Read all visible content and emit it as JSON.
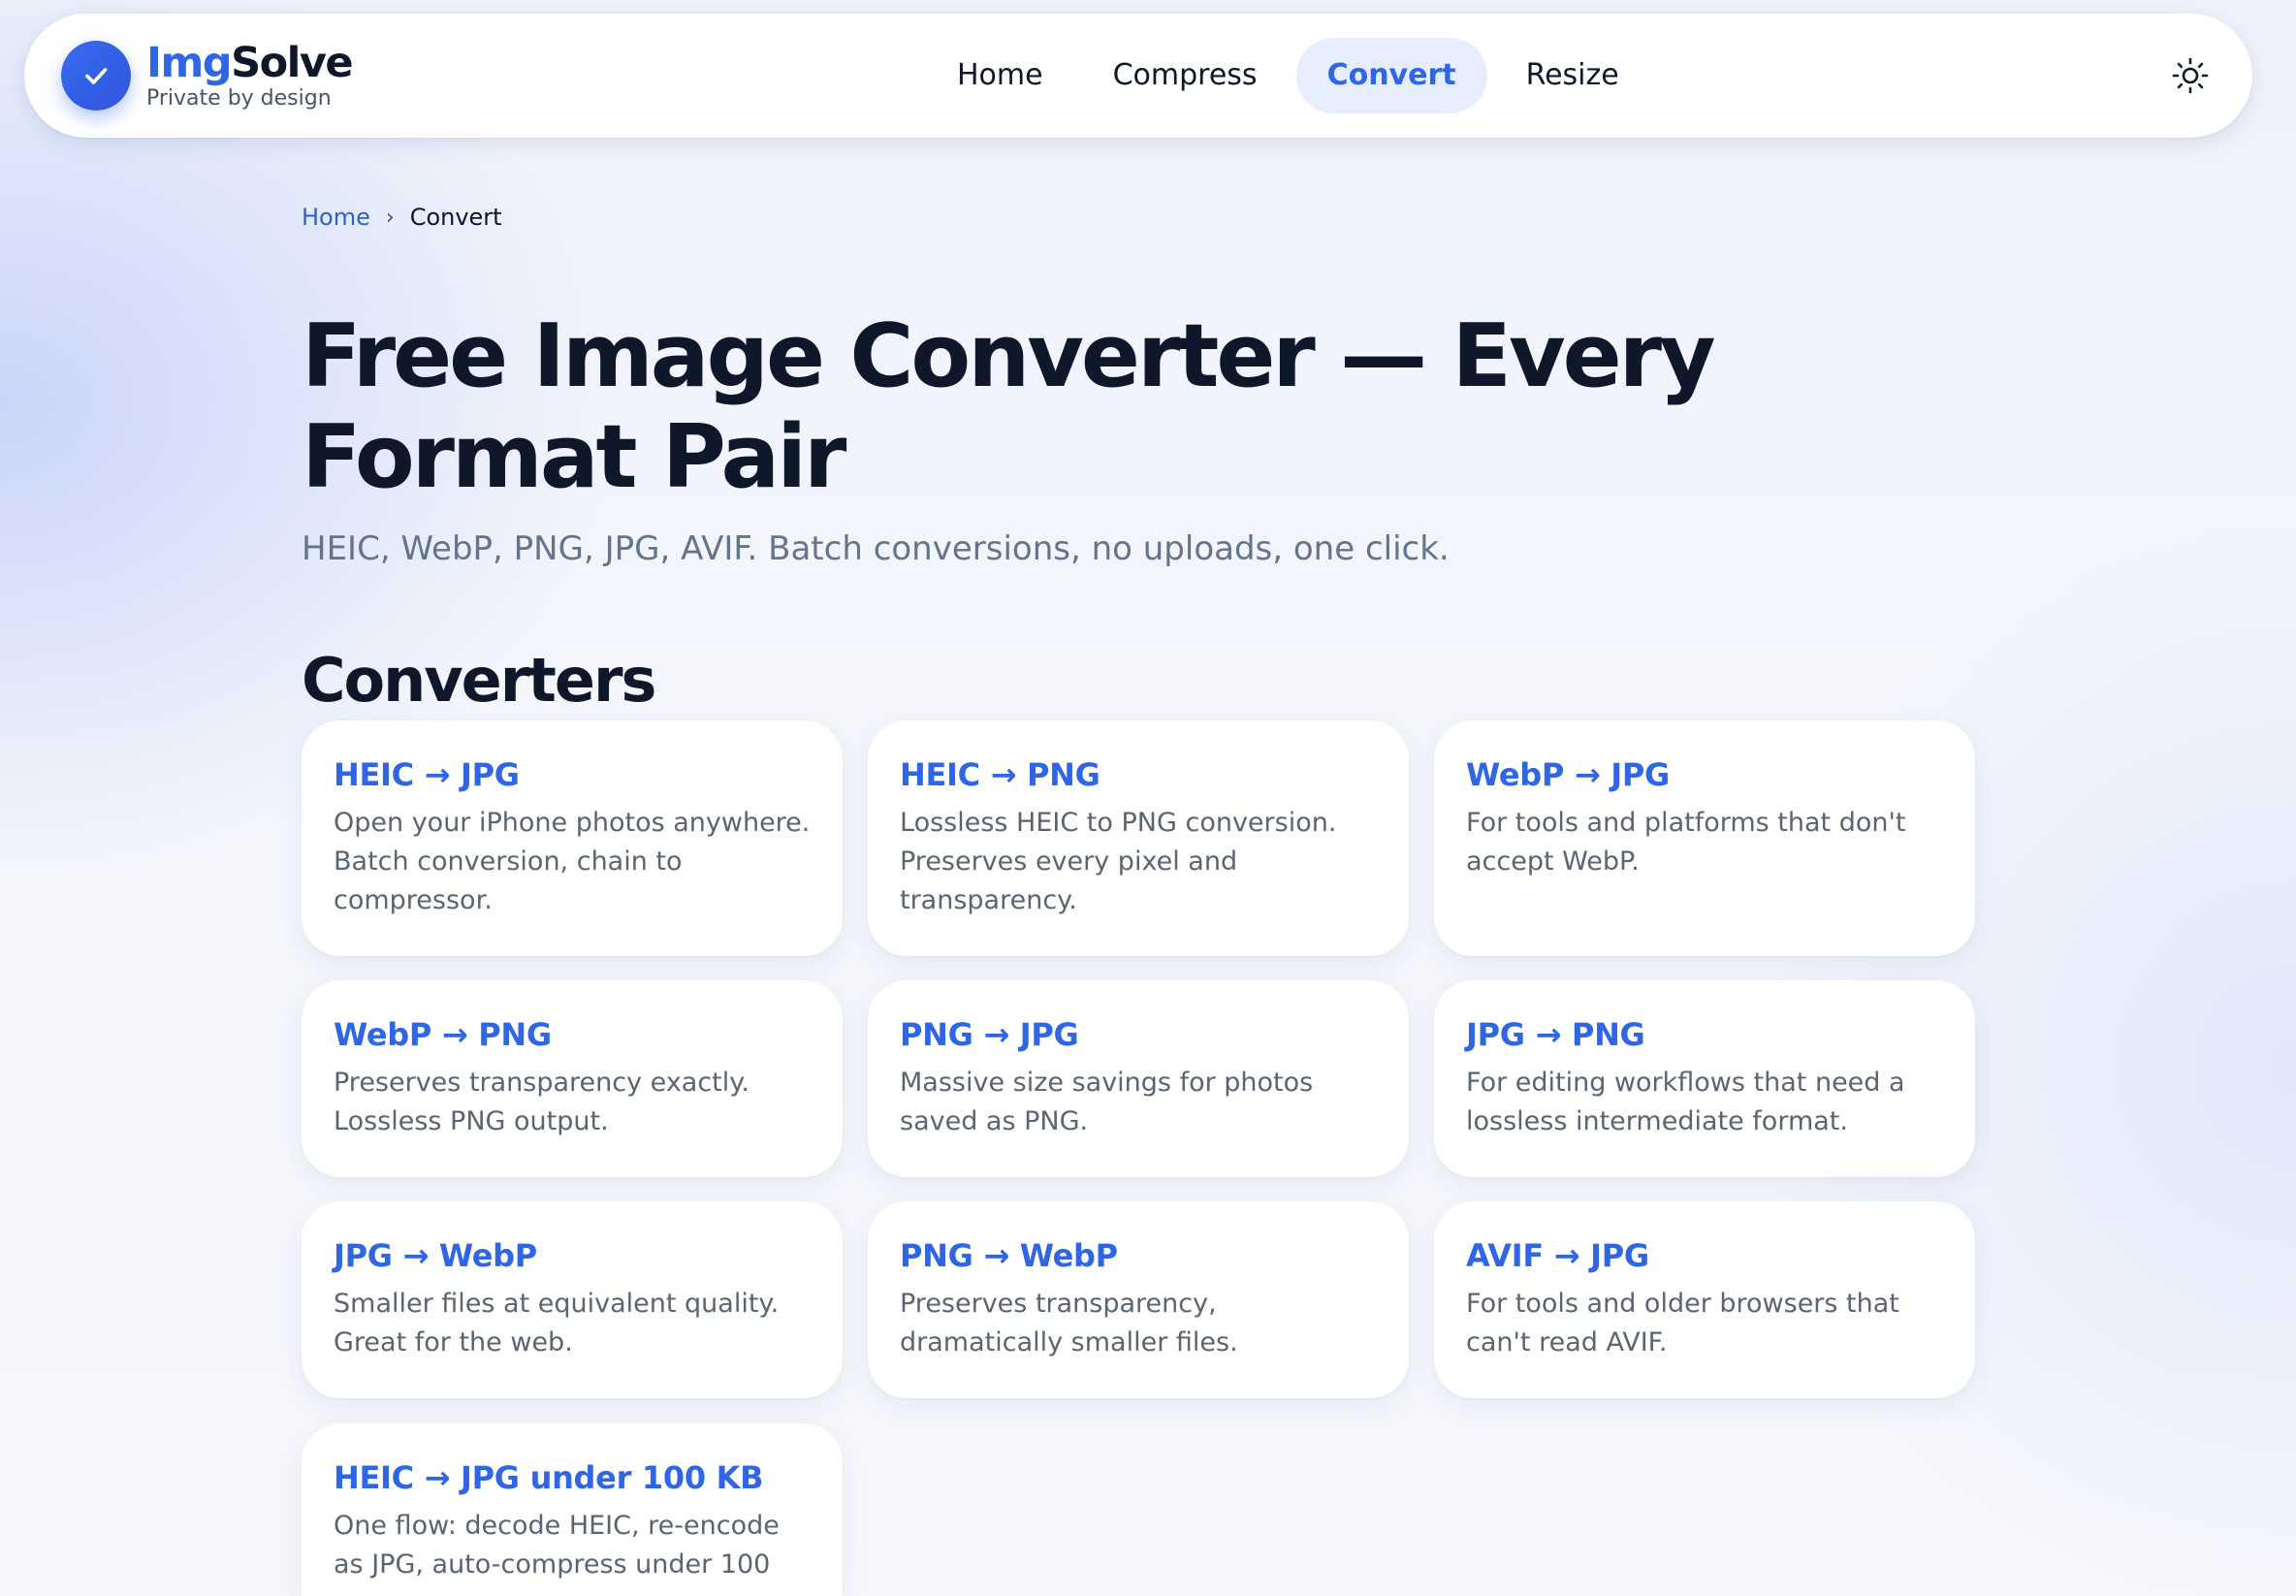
{
  "header": {
    "brand_name_part1": "Img",
    "brand_name_part2": "Solve",
    "brand_tagline": "Private by design",
    "brand_icon": "check-icon",
    "nav": [
      {
        "label": "Home",
        "active": false
      },
      {
        "label": "Compress",
        "active": false
      },
      {
        "label": "Convert",
        "active": true
      },
      {
        "label": "Resize",
        "active": false
      }
    ],
    "theme_toggle_icon": "sun-icon"
  },
  "breadcrumb": {
    "home": "Home",
    "separator": "›",
    "current": "Convert"
  },
  "page": {
    "title": "Free Image Converter — Every Format Pair",
    "subtitle": "HEIC, WebP, PNG, JPG, AVIF. Batch conversions, no uploads, one click.",
    "section_title": "Converters"
  },
  "converters": [
    {
      "title": "HEIC → JPG",
      "description": "Open your iPhone photos anywhere. Batch conversion, chain to compressor."
    },
    {
      "title": "HEIC → PNG",
      "description": "Lossless HEIC to PNG conversion. Preserves every pixel and transparency."
    },
    {
      "title": "WebP → JPG",
      "description": "For tools and platforms that don't accept WebP."
    },
    {
      "title": "WebP → PNG",
      "description": "Preserves transparency exactly. Lossless PNG output."
    },
    {
      "title": "PNG → JPG",
      "description": "Massive size savings for photos saved as PNG."
    },
    {
      "title": "JPG → PNG",
      "description": "For editing workflows that need a lossless intermediate format."
    },
    {
      "title": "JPG → WebP",
      "description": "Smaller files at equivalent quality. Great for the web."
    },
    {
      "title": "PNG → WebP",
      "description": "Preserves transparency, dramatically smaller files."
    },
    {
      "title": "AVIF → JPG",
      "description": "For tools and older browsers that can't read AVIF."
    },
    {
      "title": "HEIC → JPG under 100 KB",
      "description": "One flow: decode HEIC, re-encode as JPG, auto-compress under 100"
    }
  ],
  "colors": {
    "accent": "#2f66e6",
    "accent_soft": "#e6edfc",
    "text_primary": "#0f172a",
    "text_muted": "#64748b"
  }
}
